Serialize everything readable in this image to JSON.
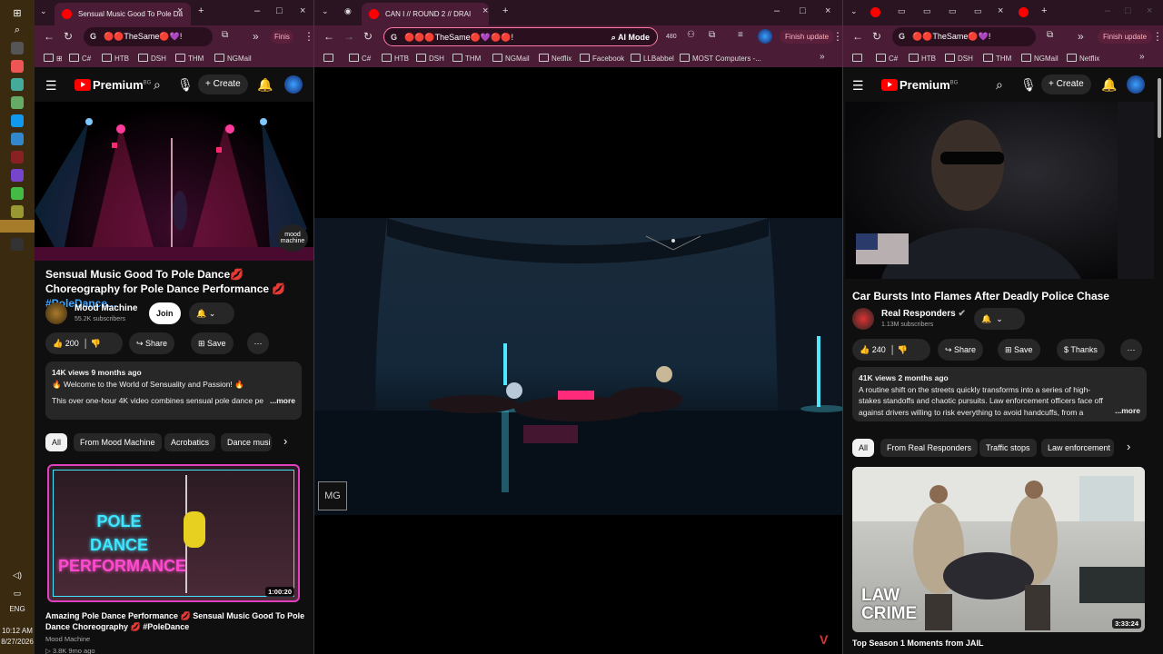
{
  "taskbar": {
    "time": "10:12 AM",
    "date": "8/27/2026",
    "lang": "ENG"
  },
  "left": {
    "tab_title": "Sensual Music Good To Pole Da",
    "omni_text": "🔴🔴TheSame🔴💜!",
    "finish": "Finis",
    "bookmarks": [
      "C#",
      "HTB",
      "DSH",
      "THM",
      "NGMail"
    ],
    "logo": "Premium",
    "logo_badge": "BG",
    "create": "Create",
    "title_part1": "Sensual Music Good To Pole Dance💋 Choreography for Pole Dance Performance 💋",
    "title_tag": "#PoleDance...",
    "channel": "Mood Machine",
    "subs": "55.2K subscribers",
    "join": "Join",
    "likes": "200",
    "share": "Share",
    "save": "Save",
    "views_line": "14K views  9 months ago",
    "desc_line1": "🔥 Welcome to the World of Sensuality and Passion! 🔥",
    "desc_line2": "This over one-hour 4K video combines sensual pole dance pe",
    "more": "...more",
    "chips": [
      "All",
      "From Mood Machine",
      "Acrobatics",
      "Dance musi"
    ],
    "thumb_text": [
      "POLE",
      "DANCE",
      "PERFORMANCE"
    ],
    "thumb_duration": "1:00:20",
    "rec_title": "Amazing Pole Dance Performance 💋 Sensual Music Good To Pole Dance Choreography 💋 #PoleDance",
    "rec_channel": "Mood Machine",
    "rec_meta": "▷ 3.8K  9mo ago",
    "watermark": "mood machine"
  },
  "mid": {
    "tab_title": "CAN I // ROUND 2 // DRAI",
    "omni_text": "🔴🔴🔴TheSame🔴💜🔴🔴!",
    "ai_mode": "AI Mode",
    "badge": "480",
    "finish": "Finish update",
    "bookmarks": [
      "C#",
      "HTB",
      "DSH",
      "THM",
      "NGMail",
      "Netflix",
      "Facebook",
      "LLBabbel",
      "MOST Computers -..."
    ],
    "overlay": "MG"
  },
  "right": {
    "omni_text": "🔴🔴TheSame🔴💜!",
    "finish": "Finish update",
    "bookmarks": [
      "C#",
      "HTB",
      "DSH",
      "THM",
      "NGMail",
      "Netflix"
    ],
    "logo": "Premium",
    "logo_badge": "BG",
    "create": "Create",
    "title": "Car Bursts Into Flames After Deadly Police Chase",
    "channel": "Real Responders",
    "subs": "1.13M subscribers",
    "likes": "240",
    "share": "Share",
    "save": "Save",
    "thanks": "Thanks",
    "views_line": "41K views  2 months ago",
    "desc": "A routine shift on the streets quickly transforms into a series of high-stakes standoffs and chaotic pursuits. Law enforcement officers face off against drivers willing to risk everything to avoid handcuffs, from a motorcyclist",
    "more": "...more",
    "chips": [
      "All",
      "From Real Responders",
      "Traffic stops",
      "Law enforcement"
    ],
    "thumb_brand1": "LAW",
    "thumb_brand2": "CRIME",
    "thumb_duration": "3:33:24",
    "rec_title": "Top Season 1 Moments from JAIL"
  }
}
